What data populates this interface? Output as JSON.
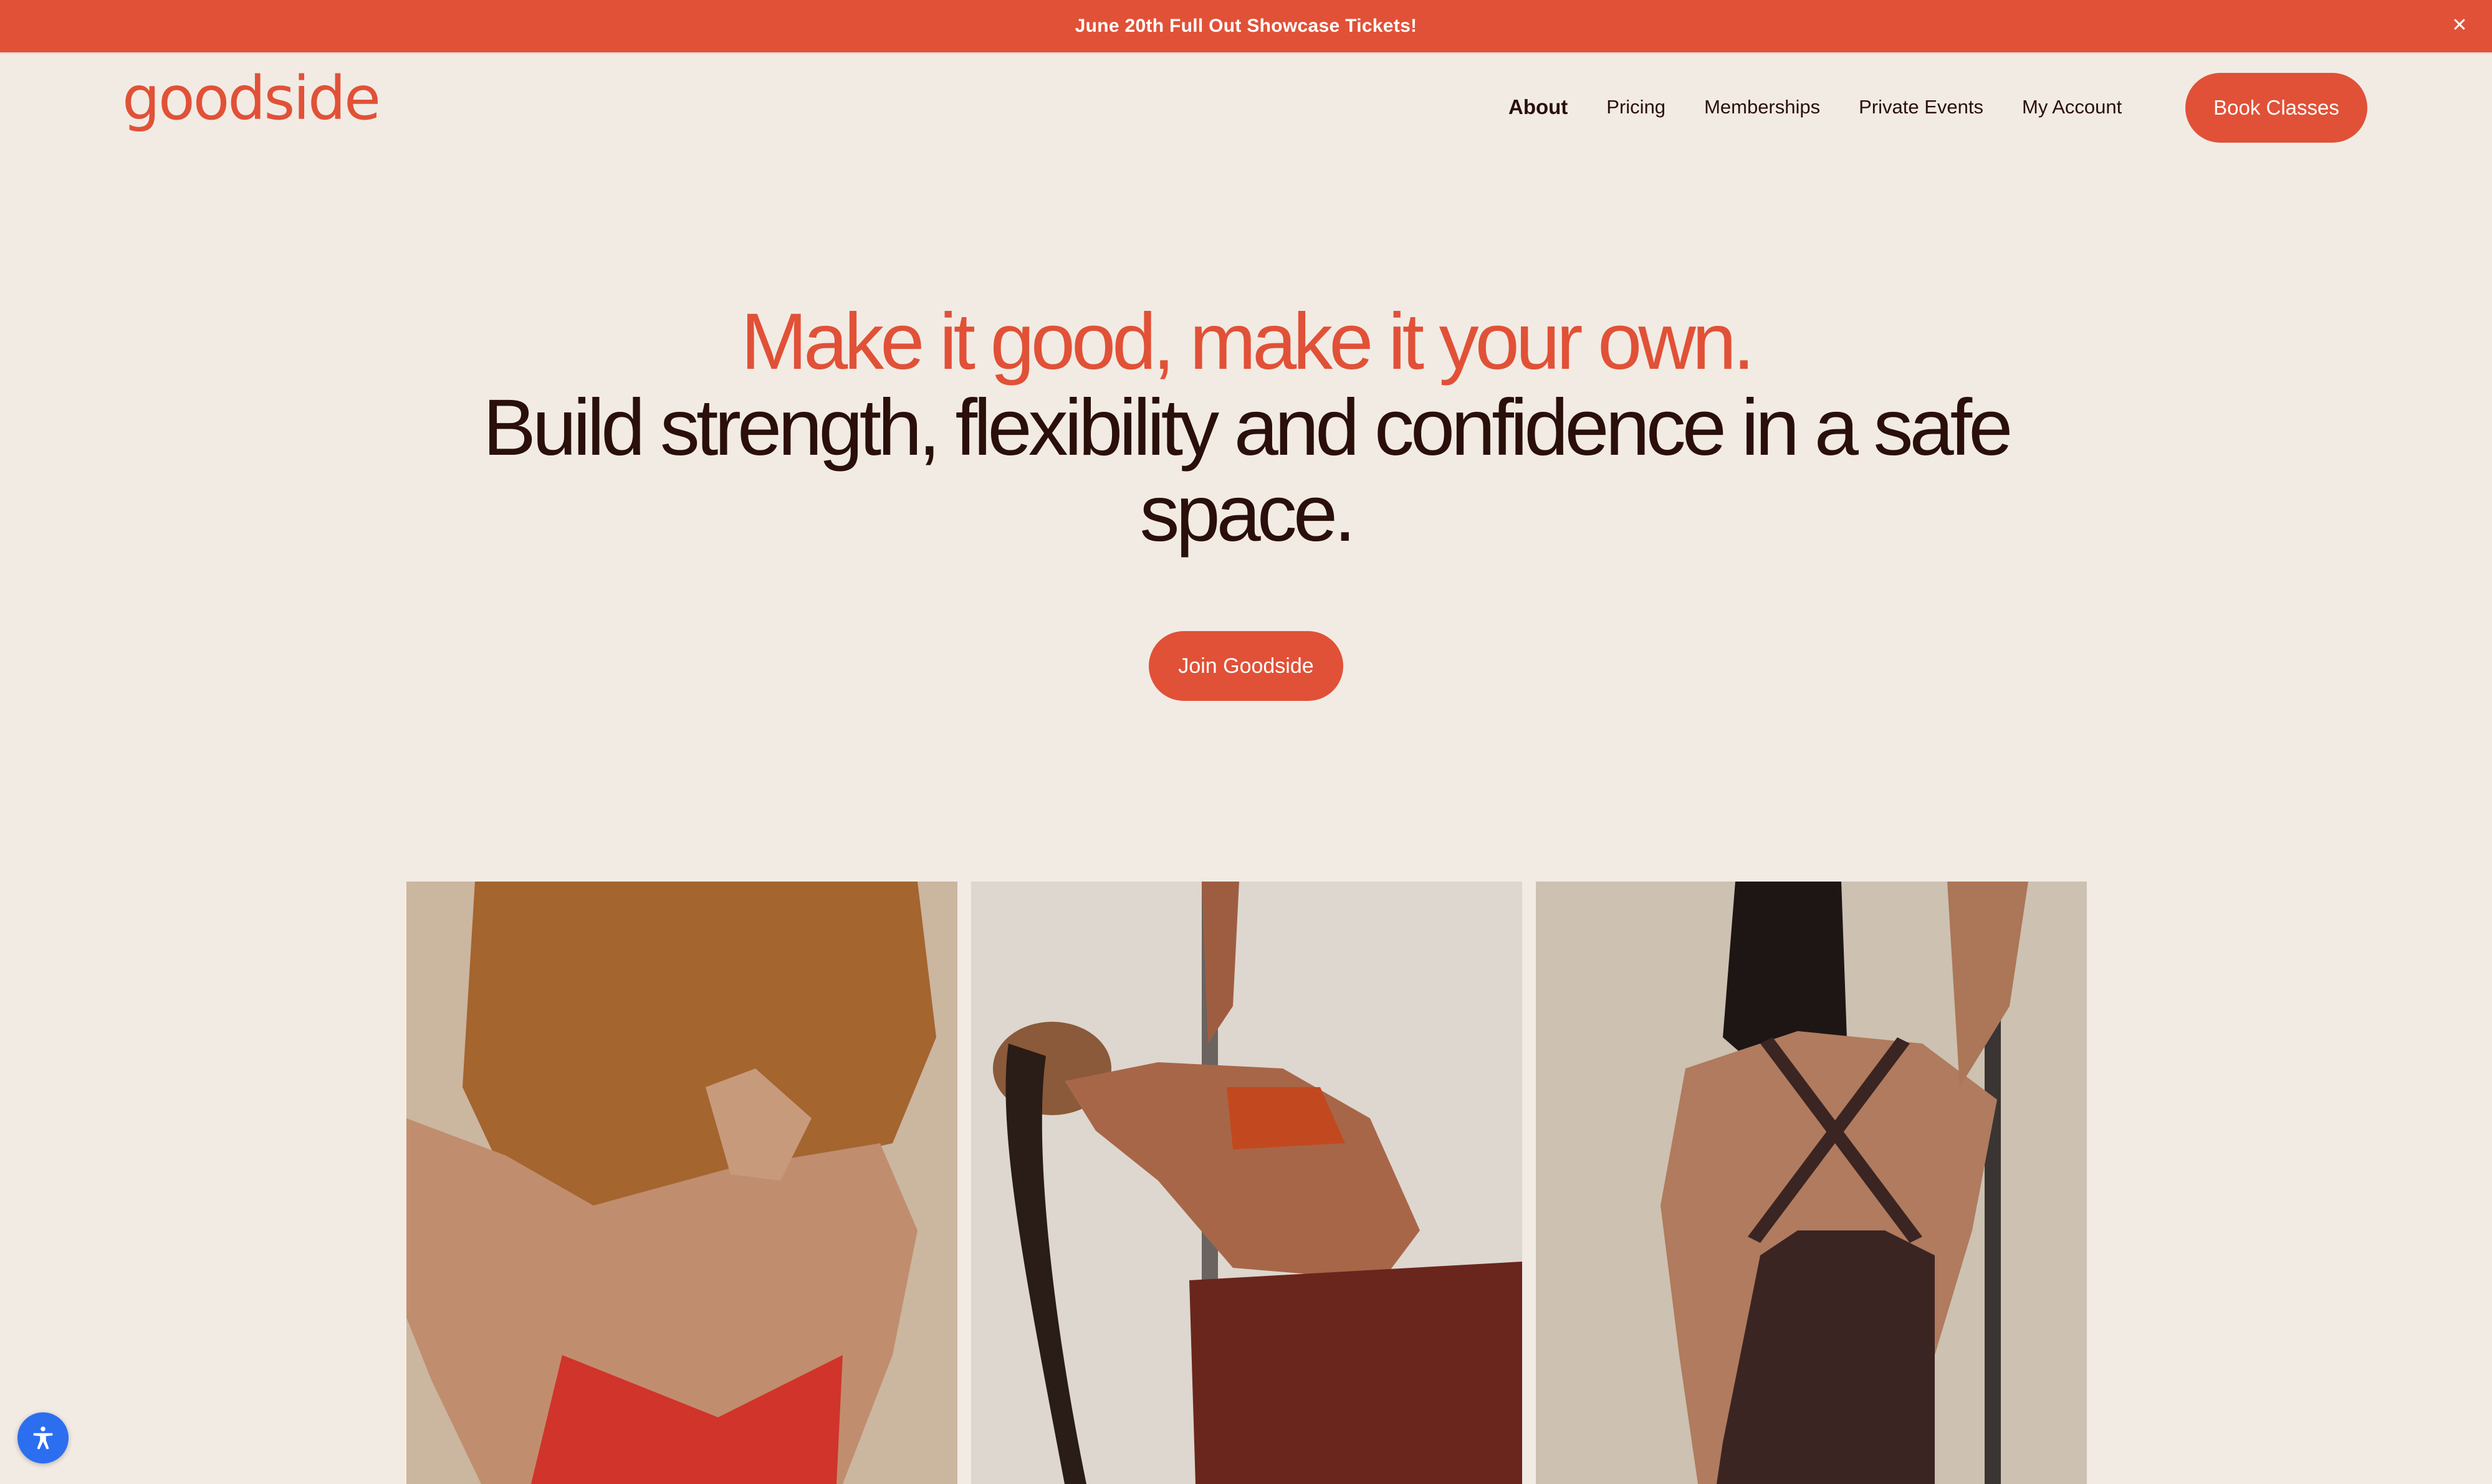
{
  "announcement": {
    "text": "June 20th Full Out Showcase Tickets!",
    "close_icon": "close-icon"
  },
  "brand": {
    "logo": "goodside",
    "accent_color": "#e15137",
    "text_color": "#2a0f0a",
    "background_color": "#f1ebe4"
  },
  "nav": {
    "items": [
      {
        "label": "About",
        "active": true
      },
      {
        "label": "Pricing",
        "active": false
      },
      {
        "label": "Memberships",
        "active": false
      },
      {
        "label": "Private Events",
        "active": false
      },
      {
        "label": "My Account",
        "active": false
      }
    ],
    "cta_label": "Book Classes"
  },
  "hero": {
    "headline": "Make it good, make it your own.",
    "subheadline": "Build strength, flexibility and confidence in a safe space.",
    "cta_label": "Join Goodside"
  },
  "accessibility": {
    "icon": "accessibility-icon"
  }
}
